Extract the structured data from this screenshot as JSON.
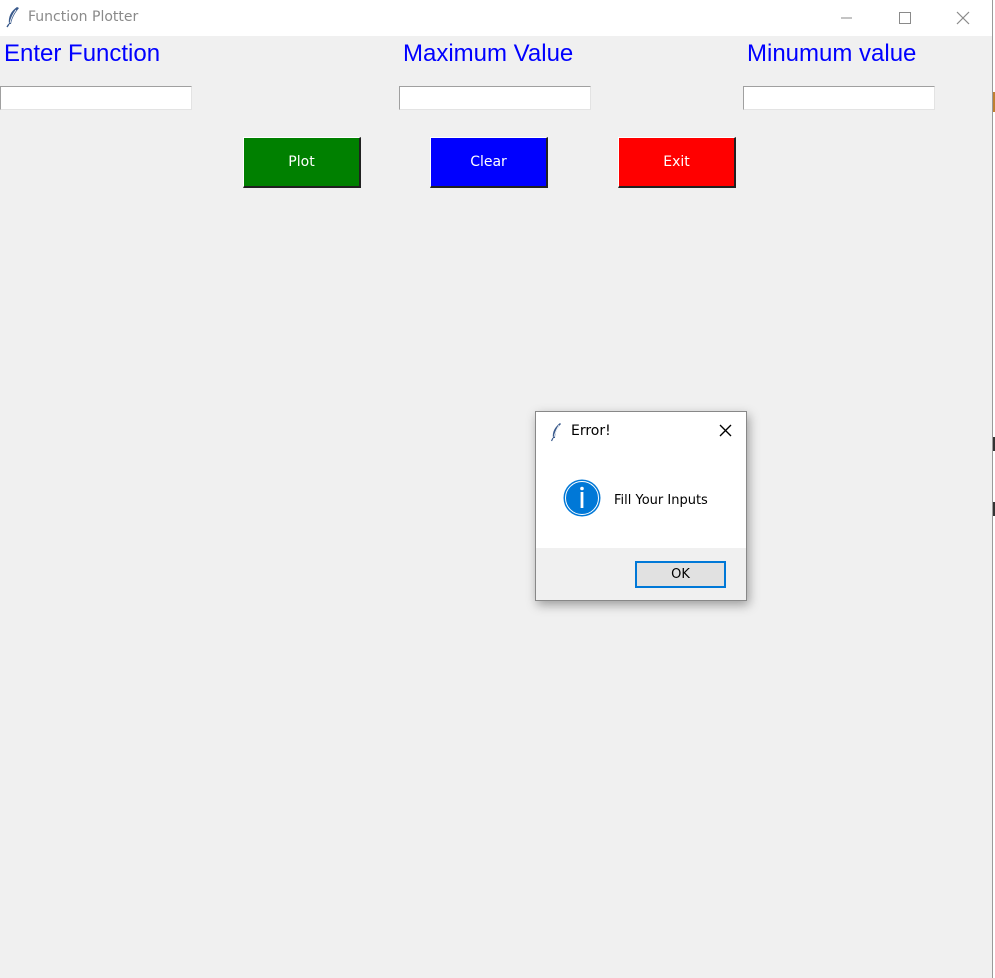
{
  "window": {
    "title": "Function Plotter",
    "icons": [
      "feather-icon",
      "minimize-icon",
      "maximize-icon",
      "close-icon"
    ]
  },
  "labels": {
    "function": "Enter Function",
    "maximum": "Maximum Value",
    "minimum": "Minumum value"
  },
  "inputs": {
    "function_value": "",
    "maximum_value": "",
    "minimum_value": ""
  },
  "buttons": {
    "plot": {
      "label": "Plot",
      "color": "#008000"
    },
    "clear": {
      "label": "Clear",
      "color": "#0000ff"
    },
    "exit": {
      "label": "Exit",
      "color": "#ff0000"
    }
  },
  "dialog": {
    "title": "Error!",
    "message": "Fill Your Inputs",
    "ok_label": "OK",
    "icons": [
      "feather-icon",
      "info-icon",
      "close-icon"
    ]
  },
  "colors": {
    "label_text": "#0000ff",
    "window_bg": "#f0f0f0",
    "focus_border": "#0078d7",
    "info_icon": "#0078d7"
  }
}
